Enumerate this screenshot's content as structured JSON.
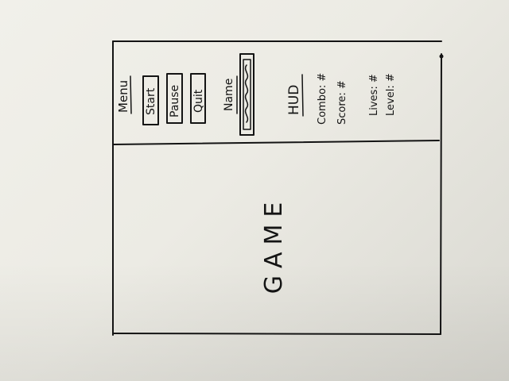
{
  "menu": {
    "title": "Menu",
    "buttons": [
      "Start",
      "Pause",
      "Quit"
    ],
    "name_label": "Name"
  },
  "hud": {
    "title": "HUD",
    "items": [
      "Combo: #",
      "Score: #",
      "Lives: #",
      "Level: #"
    ]
  },
  "game": {
    "label": "GAME"
  }
}
